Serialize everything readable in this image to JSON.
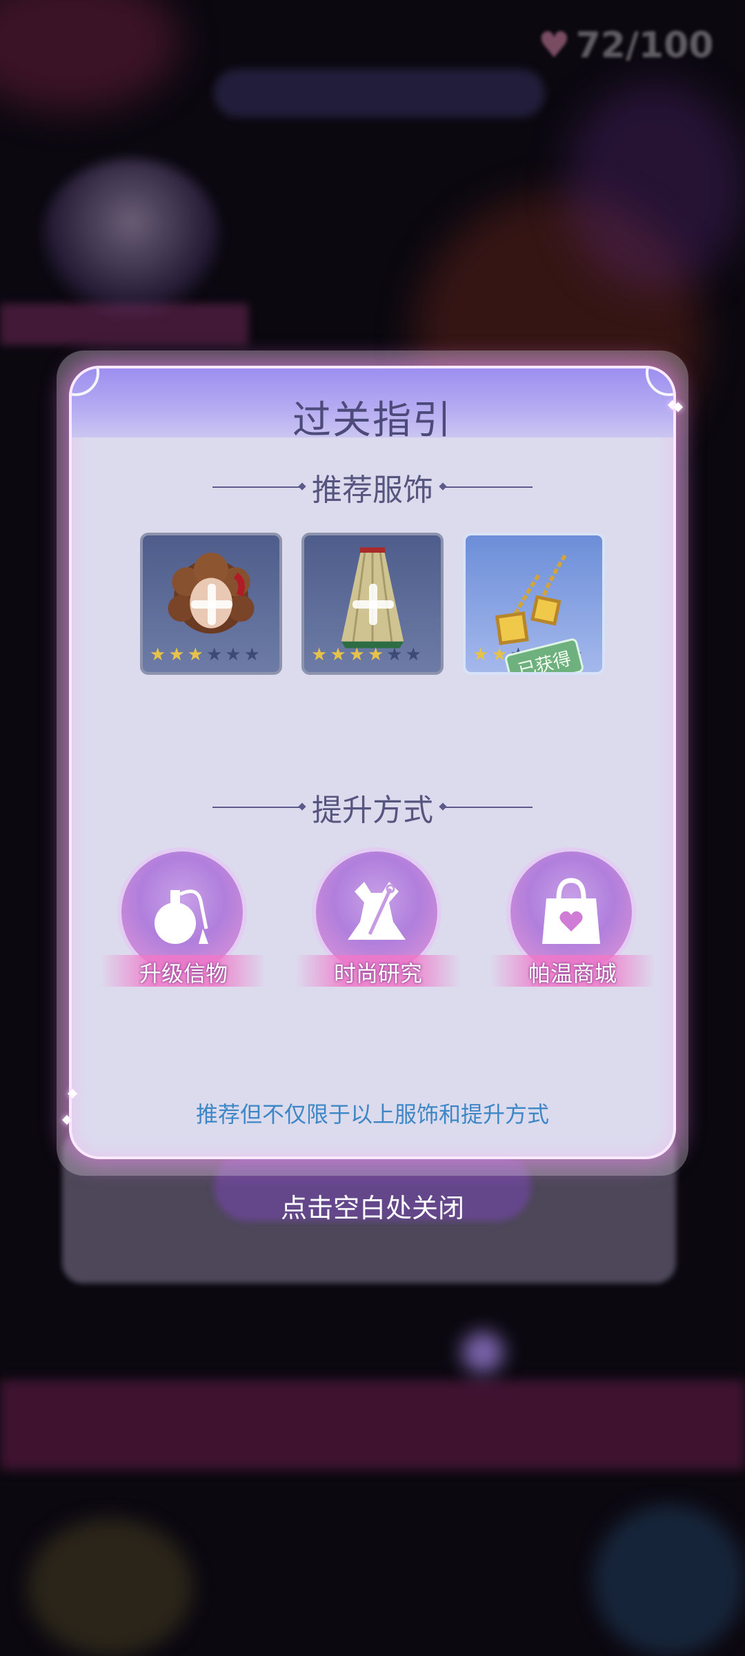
{
  "status_bar": {
    "hearts": "72/100"
  },
  "dialog": {
    "title": "过关指引",
    "section_recommended": "推荐服饰",
    "items": [
      {
        "name": "hair",
        "stars": 3,
        "max_stars": 6,
        "owned": false
      },
      {
        "name": "skirt",
        "stars": 4,
        "max_stars": 6,
        "owned": false
      },
      {
        "name": "earrings",
        "stars": 2,
        "max_stars": 6,
        "owned": true,
        "badge": "已获得"
      }
    ],
    "section_methods": "提升方式",
    "methods": [
      {
        "label": "升级信物",
        "icon": "perfume-icon"
      },
      {
        "label": "时尚研究",
        "icon": "dress-needle-icon"
      },
      {
        "label": "帕温商城",
        "icon": "shopping-bag-icon"
      }
    ],
    "note": "推荐但不仅限于以上服饰和提升方式"
  },
  "close_hint": "点击空白处关闭",
  "colors": {
    "header": "#9c8ff0",
    "panel": "#dcdbee",
    "note_text": "#3d87c6",
    "star_on": "#e7c24a"
  }
}
